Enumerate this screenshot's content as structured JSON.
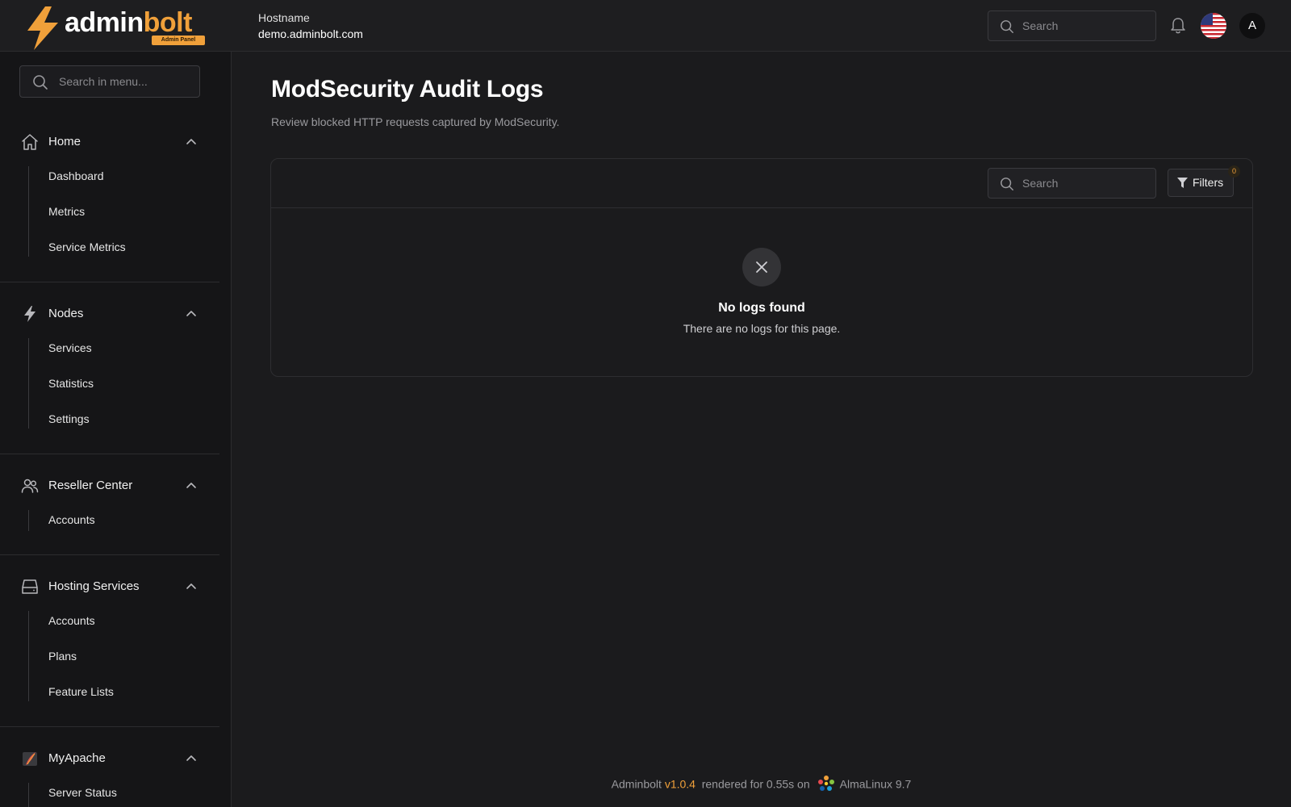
{
  "brand": {
    "name_part1": "admin",
    "name_part2": "bolt",
    "badge": "Admin Panel",
    "accent_color": "#f0a03a"
  },
  "header": {
    "hostname_label": "Hostname",
    "hostname_value": "demo.adminbolt.com",
    "search_placeholder": "Search",
    "avatar_initial": "A",
    "language_flag": "us-flag-icon",
    "notifications_icon": "bell-icon"
  },
  "sidebar": {
    "search_placeholder": "Search in menu...",
    "groups": [
      {
        "label": "Home",
        "icon": "home-icon",
        "items": [
          "Dashboard",
          "Metrics",
          "Service Metrics"
        ]
      },
      {
        "label": "Nodes",
        "icon": "bolt-icon",
        "items": [
          "Services",
          "Statistics",
          "Settings"
        ]
      },
      {
        "label": "Reseller Center",
        "icon": "users-icon",
        "items": [
          "Accounts"
        ]
      },
      {
        "label": "Hosting Services",
        "icon": "server-icon",
        "items": [
          "Accounts",
          "Plans",
          "Feature Lists"
        ]
      },
      {
        "label": "MyApache",
        "icon": "apache-feather-icon",
        "items": [
          "Server Status"
        ]
      }
    ]
  },
  "main": {
    "title": "ModSecurity Audit Logs",
    "subtitle": "Review blocked HTTP requests captured by ModSecurity.",
    "table": {
      "search_placeholder": "Search",
      "filters_label": "Filters",
      "filters_count": "0",
      "empty_title": "No logs found",
      "empty_message": "There are no logs for this page."
    }
  },
  "footer": {
    "app_name": "Adminbolt",
    "version": "v1.0.4",
    "render_text": "rendered for 0.55s on",
    "os_name": "AlmaLinux 9.7"
  }
}
